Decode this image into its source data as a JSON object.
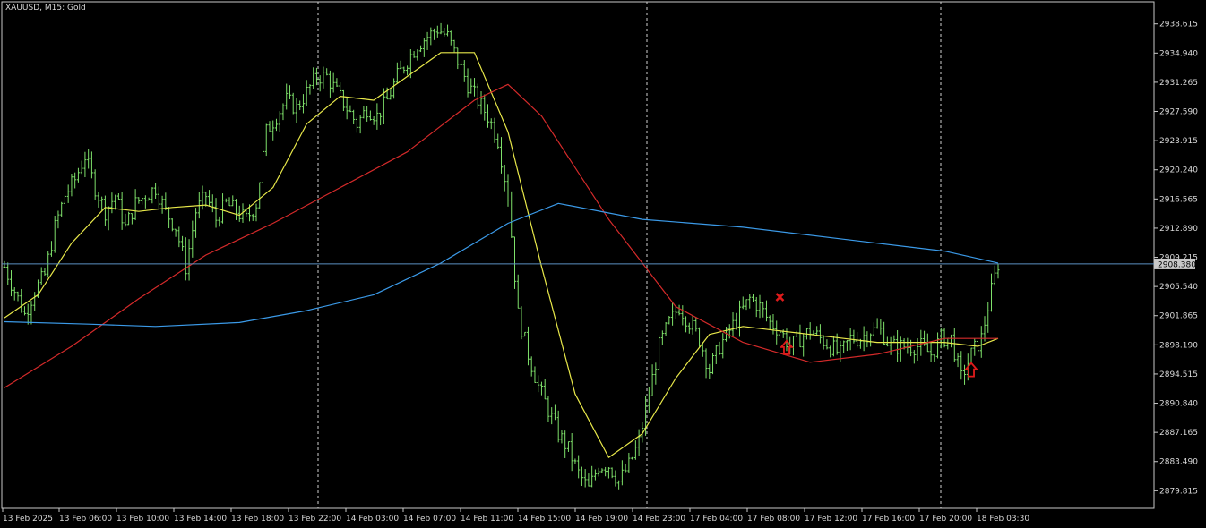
{
  "chart_title": "XAUUSD, M15:  Gold",
  "colors": {
    "background": "#000000",
    "frame": "#c8c8c8",
    "text": "#d8d8d8",
    "bar": "#7ee06a",
    "ma_fast": "#e8e84a",
    "ma_mid": "#d42a2a",
    "ma_slow": "#3b9ae8",
    "price_line": "#5b8fc2",
    "markers": "#e01b1b",
    "separator": "#d0d0d0"
  },
  "chart_data": {
    "type": "line",
    "bar_style": "ohlc",
    "symbol": "XAUUSD",
    "timeframe": "M15",
    "ylim": [
      2877.6,
      2941.4
    ],
    "y_ticks": [
      "2938.615",
      "2934.940",
      "2931.265",
      "2927.590",
      "2923.915",
      "2920.240",
      "2916.565",
      "2912.890",
      "2909.215",
      "2905.540",
      "2901.865",
      "2898.190",
      "2894.515",
      "2890.840",
      "2887.165",
      "2883.490",
      "2879.815"
    ],
    "x_ticks": [
      "13 Feb 2025",
      "13 Feb 06:00",
      "13 Feb 10:00",
      "13 Feb 14:00",
      "13 Feb 18:00",
      "13 Feb 22:00",
      "14 Feb 03:00",
      "14 Feb 07:00",
      "14 Feb 11:00",
      "14 Feb 15:00",
      "14 Feb 19:00",
      "14 Feb 23:00",
      "17 Feb 04:00",
      "17 Feb 08:00",
      "17 Feb 12:00",
      "17 Feb 16:00",
      "17 Feb 20:00",
      "18 Feb 03:30"
    ],
    "session_separators": [
      "13 Feb 22:00",
      "14 Feb 23:00",
      "17 Feb 20:00"
    ],
    "current_price": "2908.380",
    "grid": false,
    "price_path": [
      [
        0,
        2908
      ],
      [
        3,
        2905
      ],
      [
        6,
        2902
      ],
      [
        9,
        2905
      ],
      [
        12,
        2907
      ],
      [
        15,
        2913
      ],
      [
        18,
        2917
      ],
      [
        21,
        2919
      ],
      [
        24,
        2922
      ],
      [
        27,
        2918
      ],
      [
        30,
        2915
      ],
      [
        33,
        2917
      ],
      [
        36,
        2913
      ],
      [
        39,
        2916
      ],
      [
        42,
        2917
      ],
      [
        45,
        2918
      ],
      [
        48,
        2915
      ],
      [
        51,
        2913
      ],
      [
        54,
        2908
      ],
      [
        57,
        2915
      ],
      [
        60,
        2917
      ],
      [
        63,
        2914
      ],
      [
        66,
        2916
      ],
      [
        69,
        2915
      ],
      [
        72,
        2914
      ],
      [
        75,
        2916
      ],
      [
        78,
        2925
      ],
      [
        81,
        2927
      ],
      [
        84,
        2929
      ],
      [
        87,
        2928
      ],
      [
        90,
        2930
      ],
      [
        93,
        2932
      ],
      [
        96,
        2932
      ],
      [
        99,
        2930
      ],
      [
        102,
        2928
      ],
      [
        105,
        2926
      ],
      [
        108,
        2928
      ],
      [
        111,
        2927
      ],
      [
        114,
        2929
      ],
      [
        117,
        2932
      ],
      [
        120,
        2934
      ],
      [
        123,
        2936
      ],
      [
        126,
        2937
      ],
      [
        129,
        2938
      ],
      [
        132,
        2937
      ],
      [
        135,
        2934
      ],
      [
        138,
        2931
      ],
      [
        141,
        2929
      ],
      [
        144,
        2927
      ],
      [
        147,
        2924
      ],
      [
        150,
        2917
      ],
      [
        153,
        2902
      ],
      [
        156,
        2897
      ],
      [
        159,
        2893
      ],
      [
        162,
        2890
      ],
      [
        165,
        2887
      ],
      [
        168,
        2885
      ],
      [
        171,
        2882
      ],
      [
        174,
        2880
      ],
      [
        177,
        2883
      ],
      [
        180,
        2883
      ],
      [
        183,
        2881
      ],
      [
        186,
        2883
      ],
      [
        189,
        2886
      ],
      [
        192,
        2892
      ],
      [
        195,
        2898
      ],
      [
        198,
        2901
      ],
      [
        201,
        2903
      ],
      [
        204,
        2901
      ],
      [
        207,
        2899
      ],
      [
        210,
        2895
      ],
      [
        213,
        2898
      ],
      [
        216,
        2900
      ],
      [
        219,
        2902
      ],
      [
        222,
        2904
      ],
      [
        225,
        2903
      ],
      [
        228,
        2901
      ],
      [
        231,
        2900
      ],
      [
        234,
        2898
      ],
      [
        237,
        2899
      ],
      [
        240,
        2900
      ],
      [
        243,
        2899
      ],
      [
        246,
        2898
      ],
      [
        249,
        2897
      ],
      [
        252,
        2899
      ],
      [
        255,
        2899
      ],
      [
        258,
        2900
      ],
      [
        261,
        2900
      ],
      [
        264,
        2898
      ],
      [
        267,
        2898
      ],
      [
        270,
        2898
      ],
      [
        273,
        2898
      ],
      [
        276,
        2897
      ],
      [
        279,
        2899
      ],
      [
        282,
        2899
      ],
      [
        285,
        2894
      ],
      [
        288,
        2897
      ],
      [
        291,
        2899
      ],
      [
        294,
        2905
      ],
      [
        296,
        2908.4
      ]
    ],
    "series": [
      {
        "style": "line",
        "color": "#e8e84a",
        "values": [
          [
            0,
            2901.6
          ],
          [
            10,
            2904.5
          ],
          [
            20,
            2911
          ],
          [
            30,
            2915.5
          ],
          [
            40,
            2915
          ],
          [
            50,
            2915.5
          ],
          [
            60,
            2915.8
          ],
          [
            70,
            2914.5
          ],
          [
            80,
            2918
          ],
          [
            90,
            2926
          ],
          [
            100,
            2929.5
          ],
          [
            110,
            2929
          ],
          [
            120,
            2932
          ],
          [
            130,
            2935
          ],
          [
            140,
            2935
          ],
          [
            150,
            2925
          ],
          [
            160,
            2908
          ],
          [
            170,
            2892
          ],
          [
            180,
            2884
          ],
          [
            190,
            2887
          ],
          [
            200,
            2894
          ],
          [
            210,
            2899.5
          ],
          [
            220,
            2900.5
          ],
          [
            230,
            2900
          ],
          [
            240,
            2899.5
          ],
          [
            250,
            2899
          ],
          [
            260,
            2898.5
          ],
          [
            270,
            2898.5
          ],
          [
            280,
            2898.5
          ],
          [
            290,
            2898
          ],
          [
            296,
            2899
          ]
        ]
      },
      {
        "style": "line",
        "color": "#d42a2a",
        "values": [
          [
            0,
            2892.8
          ],
          [
            20,
            2898
          ],
          [
            40,
            2904
          ],
          [
            60,
            2909.5
          ],
          [
            80,
            2913.5
          ],
          [
            100,
            2918
          ],
          [
            120,
            2922.5
          ],
          [
            140,
            2929
          ],
          [
            150,
            2931
          ],
          [
            160,
            2927
          ],
          [
            180,
            2914
          ],
          [
            200,
            2903
          ],
          [
            220,
            2898.5
          ],
          [
            240,
            2896
          ],
          [
            260,
            2897
          ],
          [
            280,
            2899
          ],
          [
            296,
            2899
          ]
        ]
      },
      {
        "style": "line",
        "color": "#3b9ae8",
        "values": [
          [
            0,
            2901.1
          ],
          [
            25,
            2900.8
          ],
          [
            45,
            2900.5
          ],
          [
            70,
            2901
          ],
          [
            90,
            2902.5
          ],
          [
            110,
            2904.5
          ],
          [
            130,
            2908.5
          ],
          [
            150,
            2913.5
          ],
          [
            165,
            2916
          ],
          [
            190,
            2914
          ],
          [
            220,
            2913
          ],
          [
            250,
            2911.5
          ],
          [
            280,
            2910
          ],
          [
            296,
            2908.5
          ]
        ]
      }
    ],
    "annotations": [
      {
        "type": "cross",
        "bar": 231,
        "price": 2904.2
      },
      {
        "type": "arrow-up",
        "bar": 233,
        "price": 2897.8
      },
      {
        "type": "arrow-up",
        "bar": 288,
        "price": 2895.0
      }
    ]
  }
}
